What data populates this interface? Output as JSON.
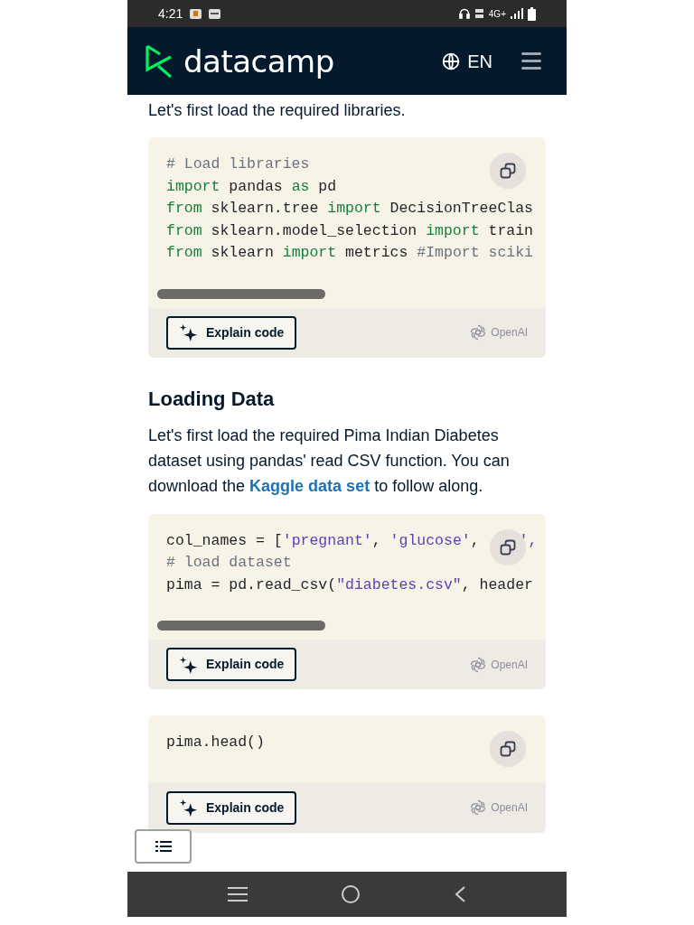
{
  "status_bar": {
    "time": "4:21",
    "network": "4G+"
  },
  "header": {
    "logo": "datacamp",
    "language": "EN"
  },
  "content": [
    {
      "kind": "paragraph",
      "text": "Let's first load the required libraries."
    },
    {
      "kind": "code",
      "lines": [
        [
          {
            "t": "# Load libraries",
            "kind": "comment"
          }
        ],
        [
          {
            "t": "import",
            "kind": "keyword"
          },
          {
            "t": " pandas ",
            "kind": "plain"
          },
          {
            "t": "as",
            "kind": "keyword"
          },
          {
            "t": " pd",
            "kind": "plain"
          }
        ],
        [
          {
            "t": "from",
            "kind": "keyword"
          },
          {
            "t": " sklearn.tree ",
            "kind": "plain"
          },
          {
            "t": "import",
            "kind": "keyword"
          },
          {
            "t": " DecisionTreeClas",
            "kind": "plain"
          }
        ],
        [
          {
            "t": "from",
            "kind": "keyword"
          },
          {
            "t": " sklearn.model_selection ",
            "kind": "plain"
          },
          {
            "t": "import",
            "kind": "keyword"
          },
          {
            "t": " train",
            "kind": "plain"
          }
        ],
        [
          {
            "t": "from",
            "kind": "keyword"
          },
          {
            "t": " sklearn ",
            "kind": "plain"
          },
          {
            "t": "import",
            "kind": "keyword"
          },
          {
            "t": " metrics ",
            "kind": "plain"
          },
          {
            "t": "#Import sciki",
            "kind": "comment"
          }
        ]
      ],
      "scrollbar": true,
      "explain": "Explain code",
      "brand": "OpenAI"
    },
    {
      "kind": "heading",
      "text": "Loading Data"
    },
    {
      "kind": "paragraph",
      "text": "Let's first load the required Pima Indian Diabetes dataset using pandas' read CSV function. You can download the ",
      "link": "Kaggle data set",
      "after": " to follow along."
    },
    {
      "kind": "code",
      "lines": [
        [
          {
            "t": "col_names = [",
            "kind": "plain"
          },
          {
            "t": "'pregnant'",
            "kind": "string"
          },
          {
            "t": ", ",
            "kind": "plain"
          },
          {
            "t": "'glucose'",
            "kind": "string"
          },
          {
            "t": ",",
            "kind": "plain"
          },
          {
            "t": "',",
            "kind": "tail"
          }
        ],
        [
          {
            "t": "# load dataset",
            "kind": "comment"
          }
        ],
        [
          {
            "t": "pima = pd.read_csv(",
            "kind": "plain"
          },
          {
            "t": "\"diabetes.csv\"",
            "kind": "string"
          },
          {
            "t": ", header",
            "kind": "plain"
          }
        ]
      ],
      "scrollbar": true,
      "explain": "Explain code",
      "brand": "OpenAI"
    },
    {
      "kind": "code",
      "lines": [
        [
          {
            "t": "pima.head()",
            "kind": "plain"
          }
        ]
      ],
      "scrollbar": false,
      "explain": "Explain code",
      "brand": "OpenAI"
    }
  ]
}
